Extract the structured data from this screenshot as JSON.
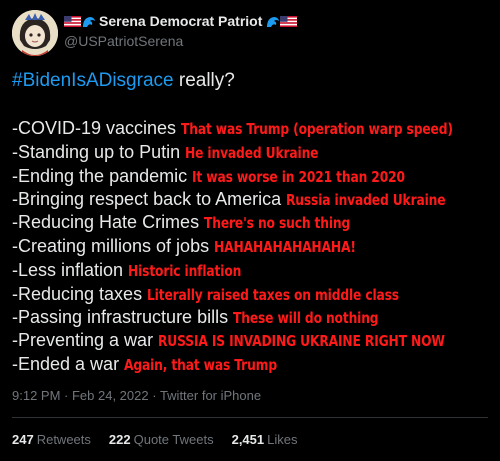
{
  "author": {
    "display_name": "Serena Democrat Patriot",
    "handle": "@USPatriotSerena"
  },
  "tweet": {
    "hashtag": "#BidenIsADisgrace",
    "rest": " really?",
    "lines": [
      {
        "item": "-COVID-19 vaccines",
        "note": "That was Trump (operation warp speed)"
      },
      {
        "item": "-Standing up to Putin",
        "note": "He invaded Ukraine"
      },
      {
        "item": "-Ending the pandemic",
        "note": "It was worse in 2021 than 2020"
      },
      {
        "item": "-Bringing respect back to America",
        "note": "Russia invaded Ukraine"
      },
      {
        "item": "-Reducing Hate Crimes",
        "note": "There's no such thing"
      },
      {
        "item": "-Creating millions of jobs",
        "note": "HAHAHAHAHAHAHA!"
      },
      {
        "item": "-Less inflation",
        "note": "Historic inflation"
      },
      {
        "item": "-Reducing taxes",
        "note": "Literally raised taxes on middle class"
      },
      {
        "item": "-Passing infrastructure bills",
        "note": "These will do nothing"
      },
      {
        "item": "-Preventing a war",
        "note": "RUSSIA IS INVADING UKRAINE RIGHT NOW"
      },
      {
        "item": "-Ended a war",
        "note": "Again, that was Trump"
      }
    ]
  },
  "meta": {
    "time": "9:12 PM",
    "sep": " · ",
    "date": "Feb 24, 2022",
    "source": "Twitter for iPhone"
  },
  "stats": {
    "retweets_count": "247",
    "retweets_label": "Retweets",
    "quotes_count": "222",
    "quotes_label": "Quote Tweets",
    "likes_count": "2,451",
    "likes_label": "Likes"
  },
  "colors": {
    "background": "#000000",
    "text": "#e7e9ea",
    "hashtag": "#1d9bf0",
    "annotation": "#ff1a1a",
    "muted": "#71767b"
  }
}
